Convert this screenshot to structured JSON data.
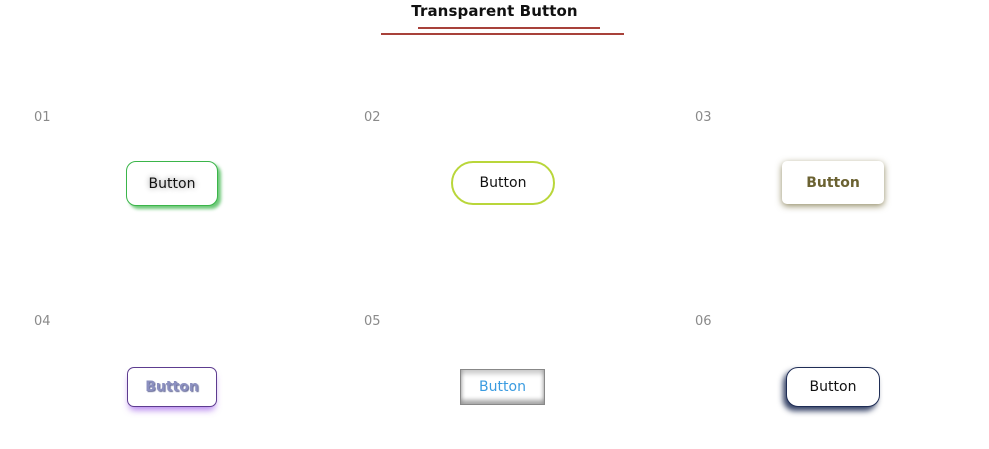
{
  "header": {
    "title": "Transparent Button"
  },
  "items": [
    {
      "number": "01",
      "label": "Button"
    },
    {
      "number": "02",
      "label": "Button"
    },
    {
      "number": "03",
      "label": "Button"
    },
    {
      "number": "04",
      "label": "Button"
    },
    {
      "number": "05",
      "label": "Button"
    },
    {
      "number": "06",
      "label": "Button"
    }
  ],
  "colors": {
    "title_underline": "#a8413a",
    "item_number": "#8a8a8a",
    "button1_accent": "#3bb54a",
    "button2_accent": "#b9d63a",
    "button3_accent": "#6b6232",
    "button4_accent": "#5d3c8f",
    "button5_text": "#3a9be0",
    "button6_accent": "#1f2d55"
  }
}
